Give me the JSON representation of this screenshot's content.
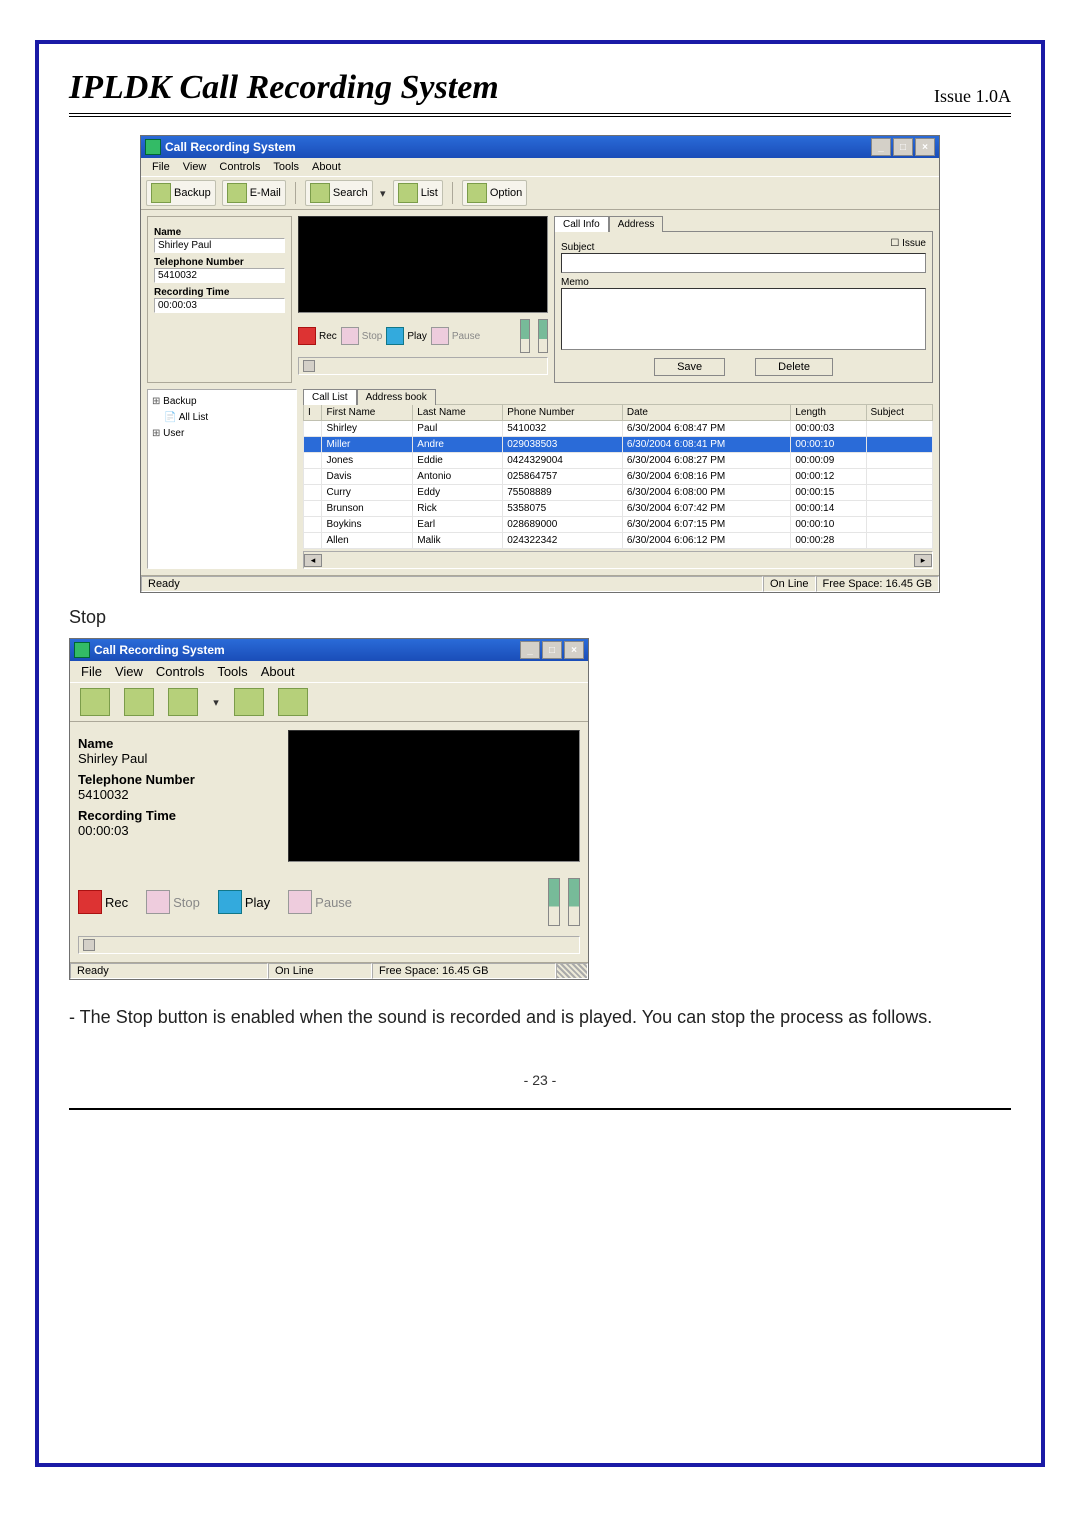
{
  "doc": {
    "title": "IPLDK Call Recording System",
    "issue": "Issue 1.0A",
    "page_number": "- 23 -",
    "section_label": "Stop",
    "body_text": "- The Stop button is enabled when the sound is recorded and is played. You can stop the process as follows."
  },
  "app": {
    "window_title": "Call Recording System",
    "menus": [
      "File",
      "View",
      "Controls",
      "Tools",
      "About"
    ],
    "toolbar": {
      "backup": "Backup",
      "email": "E-Mail",
      "search": "Search",
      "list": "List",
      "option": "Option"
    },
    "info_labels": {
      "name": "Name",
      "telephone": "Telephone Number",
      "rectime": "Recording Time"
    },
    "info_values": {
      "name": "Shirley Paul",
      "telephone": "5410032",
      "rectime": "00:00:03"
    },
    "playback": {
      "rec": "Rec",
      "stop": "Stop",
      "play": "Play",
      "pause": "Pause"
    },
    "callinfo": {
      "tabs": {
        "callinfo": "Call Info",
        "address": "Address"
      },
      "subject": "Subject",
      "memo": "Memo",
      "issue": "Issue",
      "save": "Save",
      "delete": "Delete"
    },
    "tree": {
      "backup": "Backup",
      "alllist": "All List",
      "user": "User"
    },
    "list_tabs": {
      "calllist": "Call List",
      "addressbook": "Address book"
    },
    "columns": {
      "i": "I",
      "first": "First Name",
      "last": "Last Name",
      "phone": "Phone Number",
      "date": "Date",
      "length": "Length",
      "subject": "Subject"
    },
    "rows": [
      {
        "first": "Shirley",
        "last": "Paul",
        "phone": "5410032",
        "date": "6/30/2004 6:08:47 PM",
        "len": "00:00:03",
        "subj": ""
      },
      {
        "first": "Miller",
        "last": "Andre",
        "phone": "029038503",
        "date": "6/30/2004 6:08:41 PM",
        "len": "00:00:10",
        "subj": ""
      },
      {
        "first": "Jones",
        "last": "Eddie",
        "phone": "0424329004",
        "date": "6/30/2004 6:08:27 PM",
        "len": "00:00:09",
        "subj": ""
      },
      {
        "first": "Davis",
        "last": "Antonio",
        "phone": "025864757",
        "date": "6/30/2004 6:08:16 PM",
        "len": "00:00:12",
        "subj": ""
      },
      {
        "first": "Curry",
        "last": "Eddy",
        "phone": "75508889",
        "date": "6/30/2004 6:08:00 PM",
        "len": "00:00:15",
        "subj": ""
      },
      {
        "first": "Brunson",
        "last": "Rick",
        "phone": "5358075",
        "date": "6/30/2004 6:07:42 PM",
        "len": "00:00:14",
        "subj": ""
      },
      {
        "first": "Boykins",
        "last": "Earl",
        "phone": "028689000",
        "date": "6/30/2004 6:07:15 PM",
        "len": "00:00:10",
        "subj": ""
      },
      {
        "first": "Allen",
        "last": "Malik",
        "phone": "024322342",
        "date": "6/30/2004 6:06:12 PM",
        "len": "00:00:28",
        "subj": ""
      }
    ],
    "status": {
      "ready": "Ready",
      "online": "On Line",
      "freespace": "Free Space: 16.45 GB"
    }
  }
}
